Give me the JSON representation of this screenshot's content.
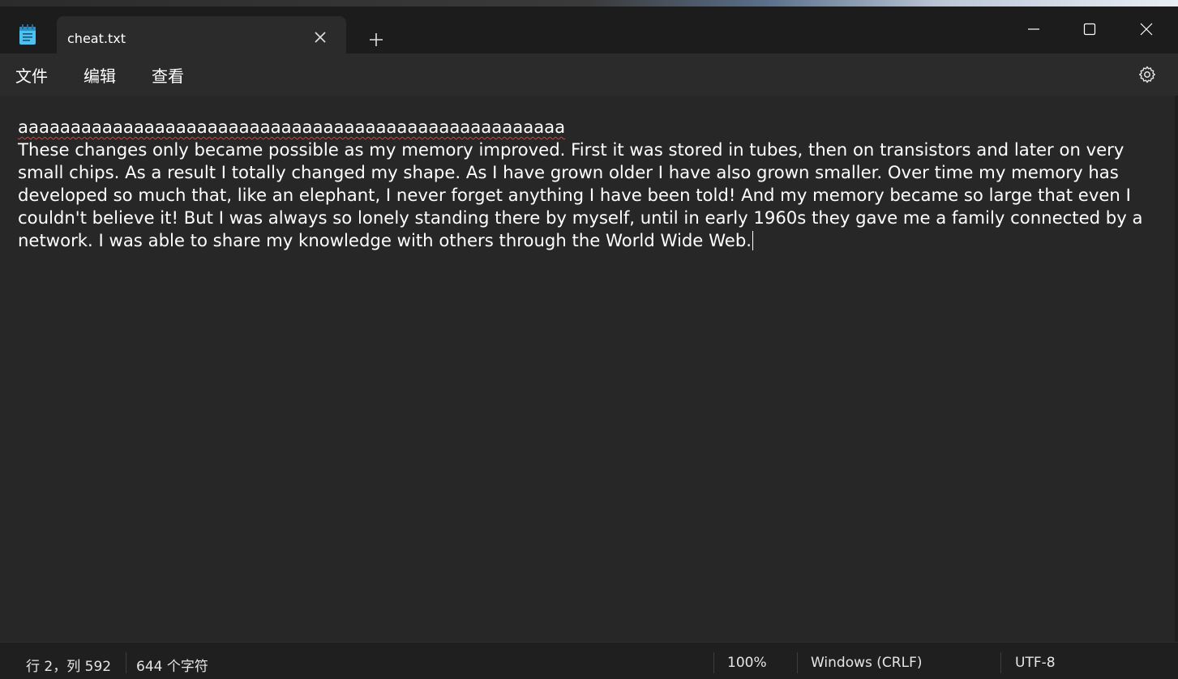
{
  "tab": {
    "title": "cheat.txt",
    "close_icon": "close-icon",
    "new_tab_icon": "plus-icon"
  },
  "window_controls": {
    "minimize_icon": "minimize-icon",
    "maximize_icon": "maximize-icon",
    "close_icon": "close-icon"
  },
  "menu": {
    "file": "文件",
    "edit": "编辑",
    "view": "查看",
    "settings_icon": "gear-icon"
  },
  "editor": {
    "line1": "aaaaaaaaaaaaaaaaaaaaaaaaaaaaaaaaaaaaaaaaaaaaaaaaaaaa",
    "line2": "These changes only became possible as my memory improved. First it was stored in tubes, then on transistors and later on very small chips. As a result I totally changed my shape. As I have grown older I have also grown smaller. Over time my memory has developed so much that, like an elephant, I never forget anything I have been told! And my memory became so large that even I couldn't believe it! But I was always so lonely standing there by myself, until in early 1960s they gave me a family connected by a network. I was able to share my knowledge with others through the World Wide Web."
  },
  "status": {
    "position": "行 2，列 592",
    "char_count": "644 个字符",
    "zoom": "100%",
    "line_ending": "Windows (CRLF)",
    "encoding": "UTF-8"
  },
  "colors": {
    "titlebar": "#1c1c1c",
    "tab_active": "#2b2b2b",
    "editor_bg": "#272727",
    "spell_error": "#e23b3b",
    "icon_blue": "#4fc1f0"
  }
}
